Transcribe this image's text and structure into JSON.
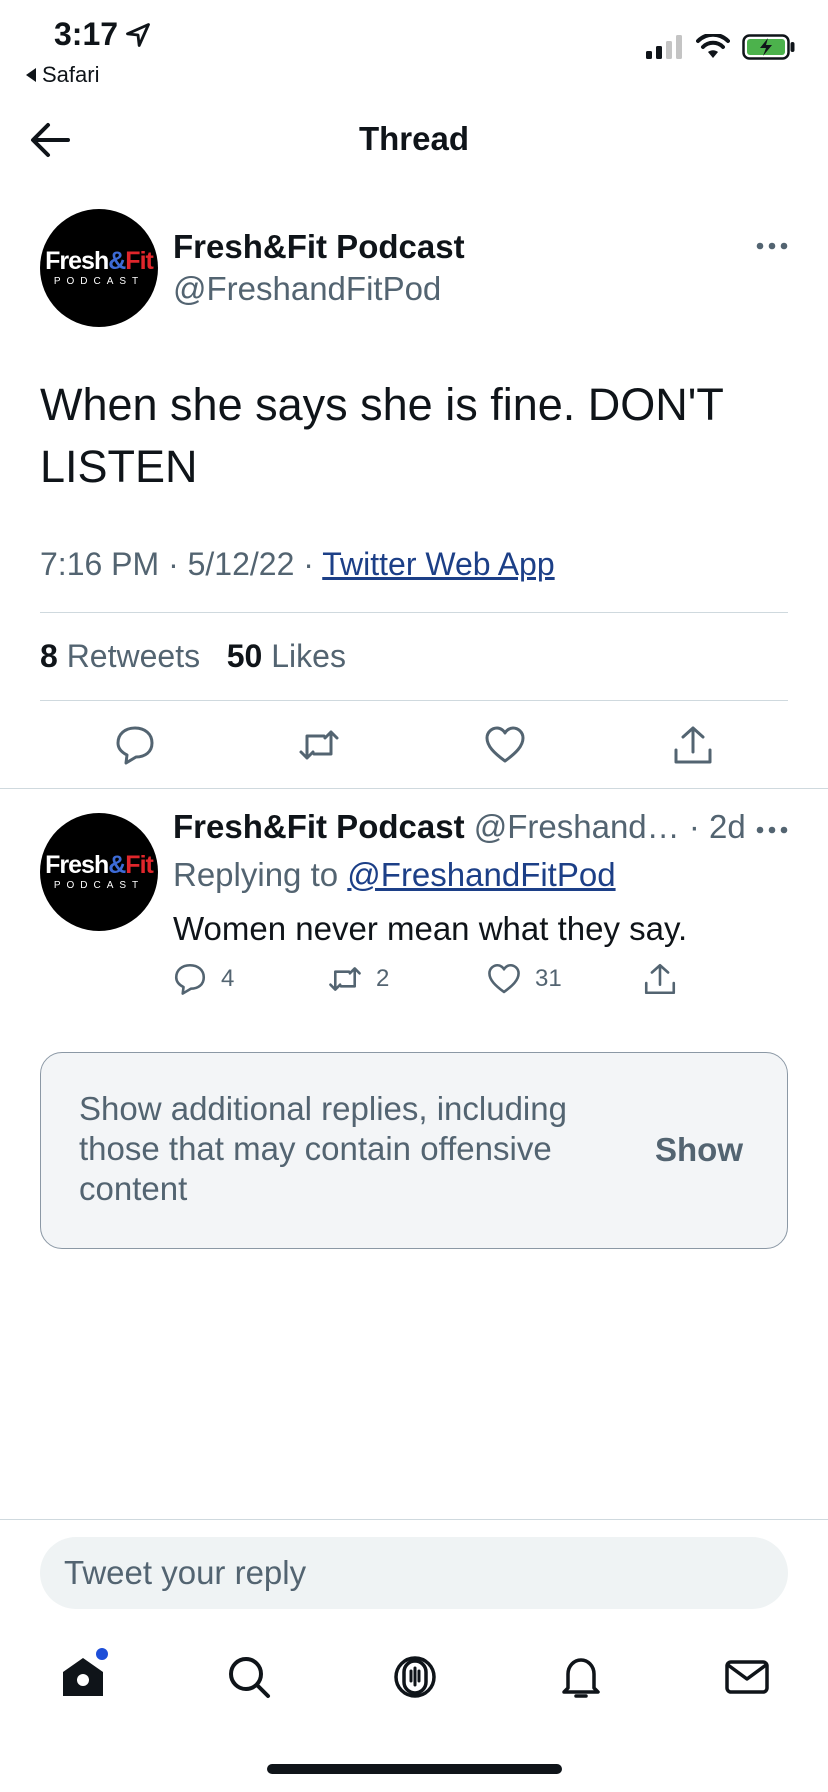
{
  "status_bar": {
    "time": "3:17",
    "back_app": "Safari",
    "battery_color": "#4cb24c"
  },
  "nav": {
    "title": "Thread"
  },
  "main_tweet": {
    "avatar_logo": [
      "Fresh",
      "&",
      "Fit",
      "PODCAST"
    ],
    "name": "Fresh&Fit Podcast",
    "handle": "@FreshandFitPod",
    "text": "When she says she is fine. DON'T LISTEN",
    "time": "7:16 PM",
    "date": "5/12/22",
    "source": "Twitter Web App",
    "retweets_count": "8",
    "retweets_label": "Retweets",
    "likes_count": "50",
    "likes_label": "Likes"
  },
  "reply": {
    "name": "Fresh&Fit Podcast",
    "handle": "@Freshand…",
    "age": "2d",
    "replying_prefix": "Replying to",
    "replying_to": "@FreshandFitPod",
    "text": "Women never mean what they say.",
    "replies": "4",
    "retweets": "2",
    "likes": "31"
  },
  "show_more": {
    "message": "Show additional replies, including those that may contain offensive content",
    "button": "Show"
  },
  "composer": {
    "placeholder": "Tweet your reply"
  },
  "tabbar": {
    "icons": [
      "home-icon",
      "search-icon",
      "spaces-icon",
      "notifications-icon",
      "messages-icon"
    ],
    "accent": "#1d4ed8"
  }
}
